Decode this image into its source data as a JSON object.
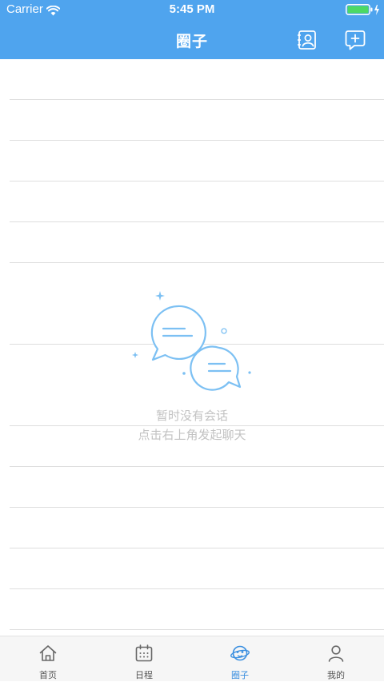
{
  "status_bar": {
    "carrier": "Carrier",
    "time": "5:45 PM"
  },
  "header": {
    "title": "圈子"
  },
  "empty_state": {
    "line1": "暂时没有会话",
    "line2": "点击右上角发起聊天"
  },
  "tabbar": {
    "tabs": [
      {
        "label": "首页",
        "icon": "home-icon",
        "active": false
      },
      {
        "label": "日程",
        "icon": "calendar-icon",
        "active": false
      },
      {
        "label": "圈子",
        "icon": "planet-icon",
        "active": true
      },
      {
        "label": "我的",
        "icon": "person-icon",
        "active": false
      }
    ]
  },
  "colors": {
    "header_bg": "#4fa4ee",
    "accent": "#3a8fe0",
    "illustration": "#7cc0f3",
    "empty_text": "#c2c2c2",
    "battery": "#4cd964"
  }
}
